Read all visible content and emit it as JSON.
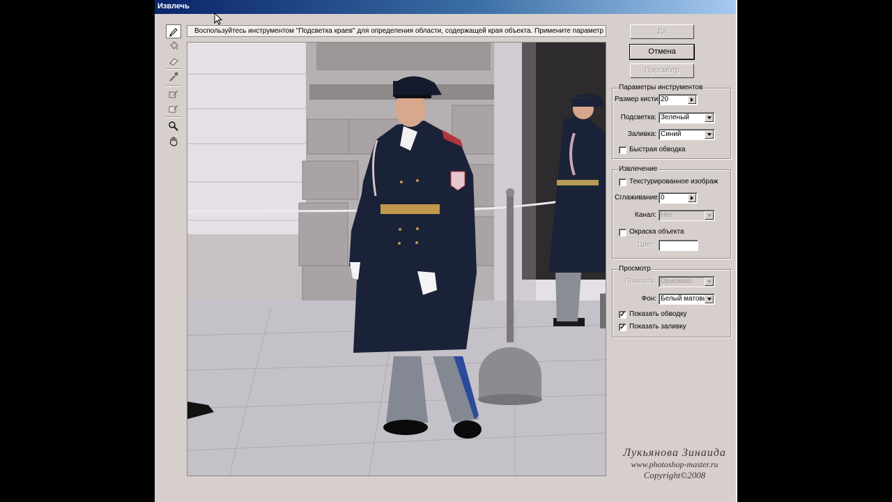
{
  "window": {
    "title": "Извлечь"
  },
  "hint": {
    "text": "Воспользуйтесь инструментом \"Подсветка краев\" для определения области, содержащей края объекта. Примените параметр \"Быстрая обво"
  },
  "buttons": {
    "ok": "Да",
    "cancel": "Отмена",
    "preview": "Просмотр"
  },
  "tool_options": {
    "title": "Параметры инструментов",
    "brush_size_label": "Размер кисти:",
    "brush_size_value": "20",
    "highlight_label": "Подсветка:",
    "highlight_value": "Зеленый",
    "fill_label": "Заливка:",
    "fill_value": "Синий",
    "smart_highlight_label": "Быстрая обводка",
    "smart_highlight_checked": false
  },
  "extraction": {
    "title": "Извлечение",
    "textured_label": "Текстурированное изображ",
    "textured_checked": false,
    "smooth_label": "Сглаживание:",
    "smooth_value": "0",
    "channel_label": "Канал:",
    "channel_value": "Нет",
    "force_color_label": "Окраска объекта",
    "force_color_checked": false,
    "color_label": "Цвет:"
  },
  "preview_group": {
    "title": "Просмотр",
    "show_label": "Показать:",
    "show_value": "Оригинал",
    "bg_label": "Фон:",
    "bg_value": "Белый матовы",
    "show_highlight_label": "Показать обводку",
    "show_highlight_checked": true,
    "show_fill_label": "Показать заливку",
    "show_fill_checked": true
  },
  "watermark": {
    "name": "Лукьянова Зинаида",
    "site": "www.photoshop-master.ru",
    "copyright": "Copyright©2008"
  },
  "colors": {
    "dialog_bg": "#d6cfcc",
    "titlebar_start": "#0a246a",
    "titlebar_end": "#a6caf0",
    "coat": "#1a2238"
  },
  "icons": [
    "edge-highlighter-icon",
    "fill-bucket-icon",
    "eraser-icon",
    "eyedropper-icon",
    "cleanup-icon",
    "edge-touchup-icon",
    "zoom-icon",
    "hand-icon"
  ]
}
